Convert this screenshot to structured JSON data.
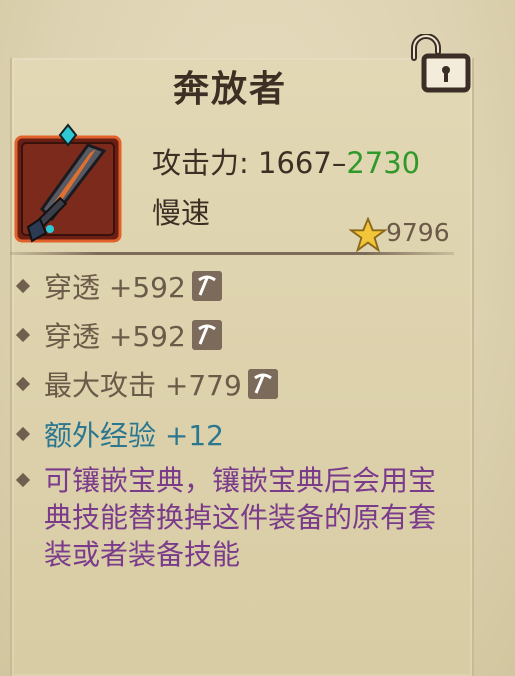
{
  "item": {
    "name": "奔放者",
    "attack_label": "攻击力: ",
    "attack_min": "1667",
    "attack_sep": "–",
    "attack_max": "2730",
    "speed": "慢速",
    "score": "9796"
  },
  "stats": [
    {
      "label": "穿透 +592",
      "socket": true
    },
    {
      "label": "穿透 +592",
      "socket": true
    },
    {
      "label": "最大攻击 +779",
      "socket": true
    },
    {
      "label": "额外经验 +12",
      "socket": false
    }
  ],
  "description": "可镶嵌宝典，镶嵌宝典后会用宝典技能替换掉这件装备的原有套装或者装备技能",
  "colors": {
    "title": "#3e2f24",
    "attack_max": "#2f9a2a",
    "bonus_stat": "#2b7790",
    "description": "#7b3b8b"
  },
  "icons": [
    "unlock-icon",
    "sword-icon",
    "star-icon",
    "pickaxe-icon"
  ]
}
